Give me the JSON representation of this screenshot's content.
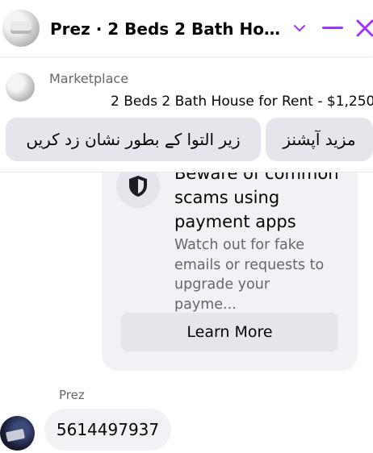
{
  "header": {
    "title": "Prez · 2 Beds 2 Bath House for Rent - $1,250",
    "accent_color": "#a033ff",
    "icons": [
      "chevron-down-icon",
      "minimize-icon",
      "close-icon"
    ]
  },
  "context": {
    "source": "Marketplace",
    "listing": "2 Beds 2 Bath House for Rent - $1,250",
    "actions": {
      "mark_pending": "زیر التوا کے بطور نشان زد کریں",
      "more_options": "مزید آپشنز"
    }
  },
  "card": {
    "icon": "shield-icon",
    "title": "Beware of common scams using payment apps",
    "body": "Watch out for fake emails or requests to upgrade your payme...",
    "button": "Learn More"
  },
  "message": {
    "sender": "Prez",
    "text": "5614497937"
  }
}
